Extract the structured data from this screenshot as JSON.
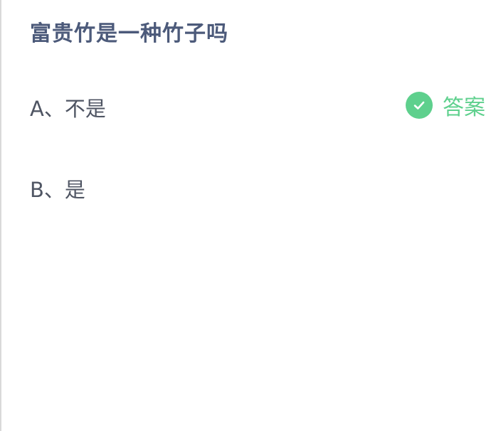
{
  "question": {
    "title": "富贵竹是一种竹子吗"
  },
  "options": [
    {
      "label": "A、不是",
      "is_answer": true
    },
    {
      "label": "B、是",
      "is_answer": false
    }
  ],
  "answer_mark": {
    "label": "答案",
    "icon": "check-circle-icon",
    "color": "#5ed08d"
  },
  "colors": {
    "title": "#4c5a7a",
    "option_text": "#4f5563",
    "background": "#ffffff"
  }
}
